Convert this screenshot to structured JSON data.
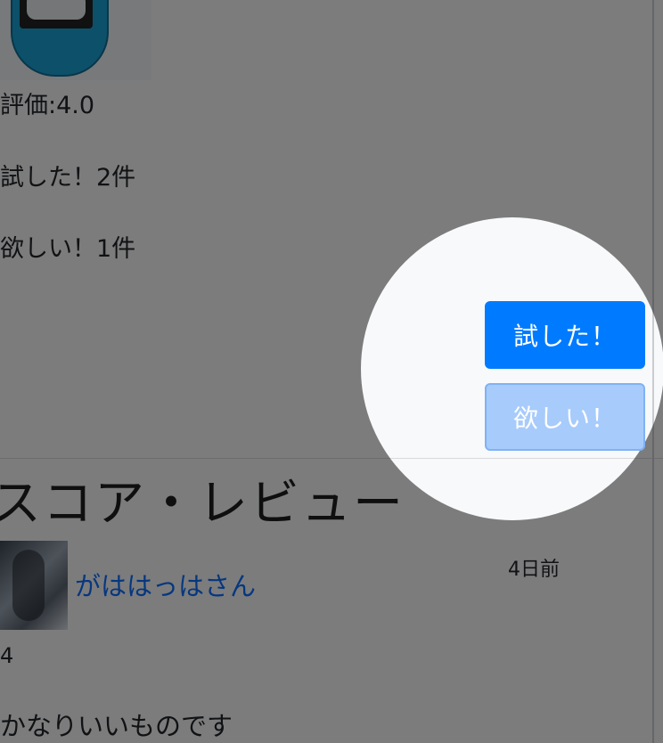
{
  "product": {
    "rating_text": "評価:4.0",
    "tried_count_text": "試した！2件",
    "want_count_text": "欲しい！1件"
  },
  "actions": {
    "tried_button": "試した！",
    "want_button": "欲しい！"
  },
  "reviews_section": {
    "title": "スコア・レビュー",
    "items": [
      {
        "user_name": "がははっはさん",
        "time": "4日前",
        "score": "4",
        "comment": "かなりいいものです"
      }
    ]
  }
}
